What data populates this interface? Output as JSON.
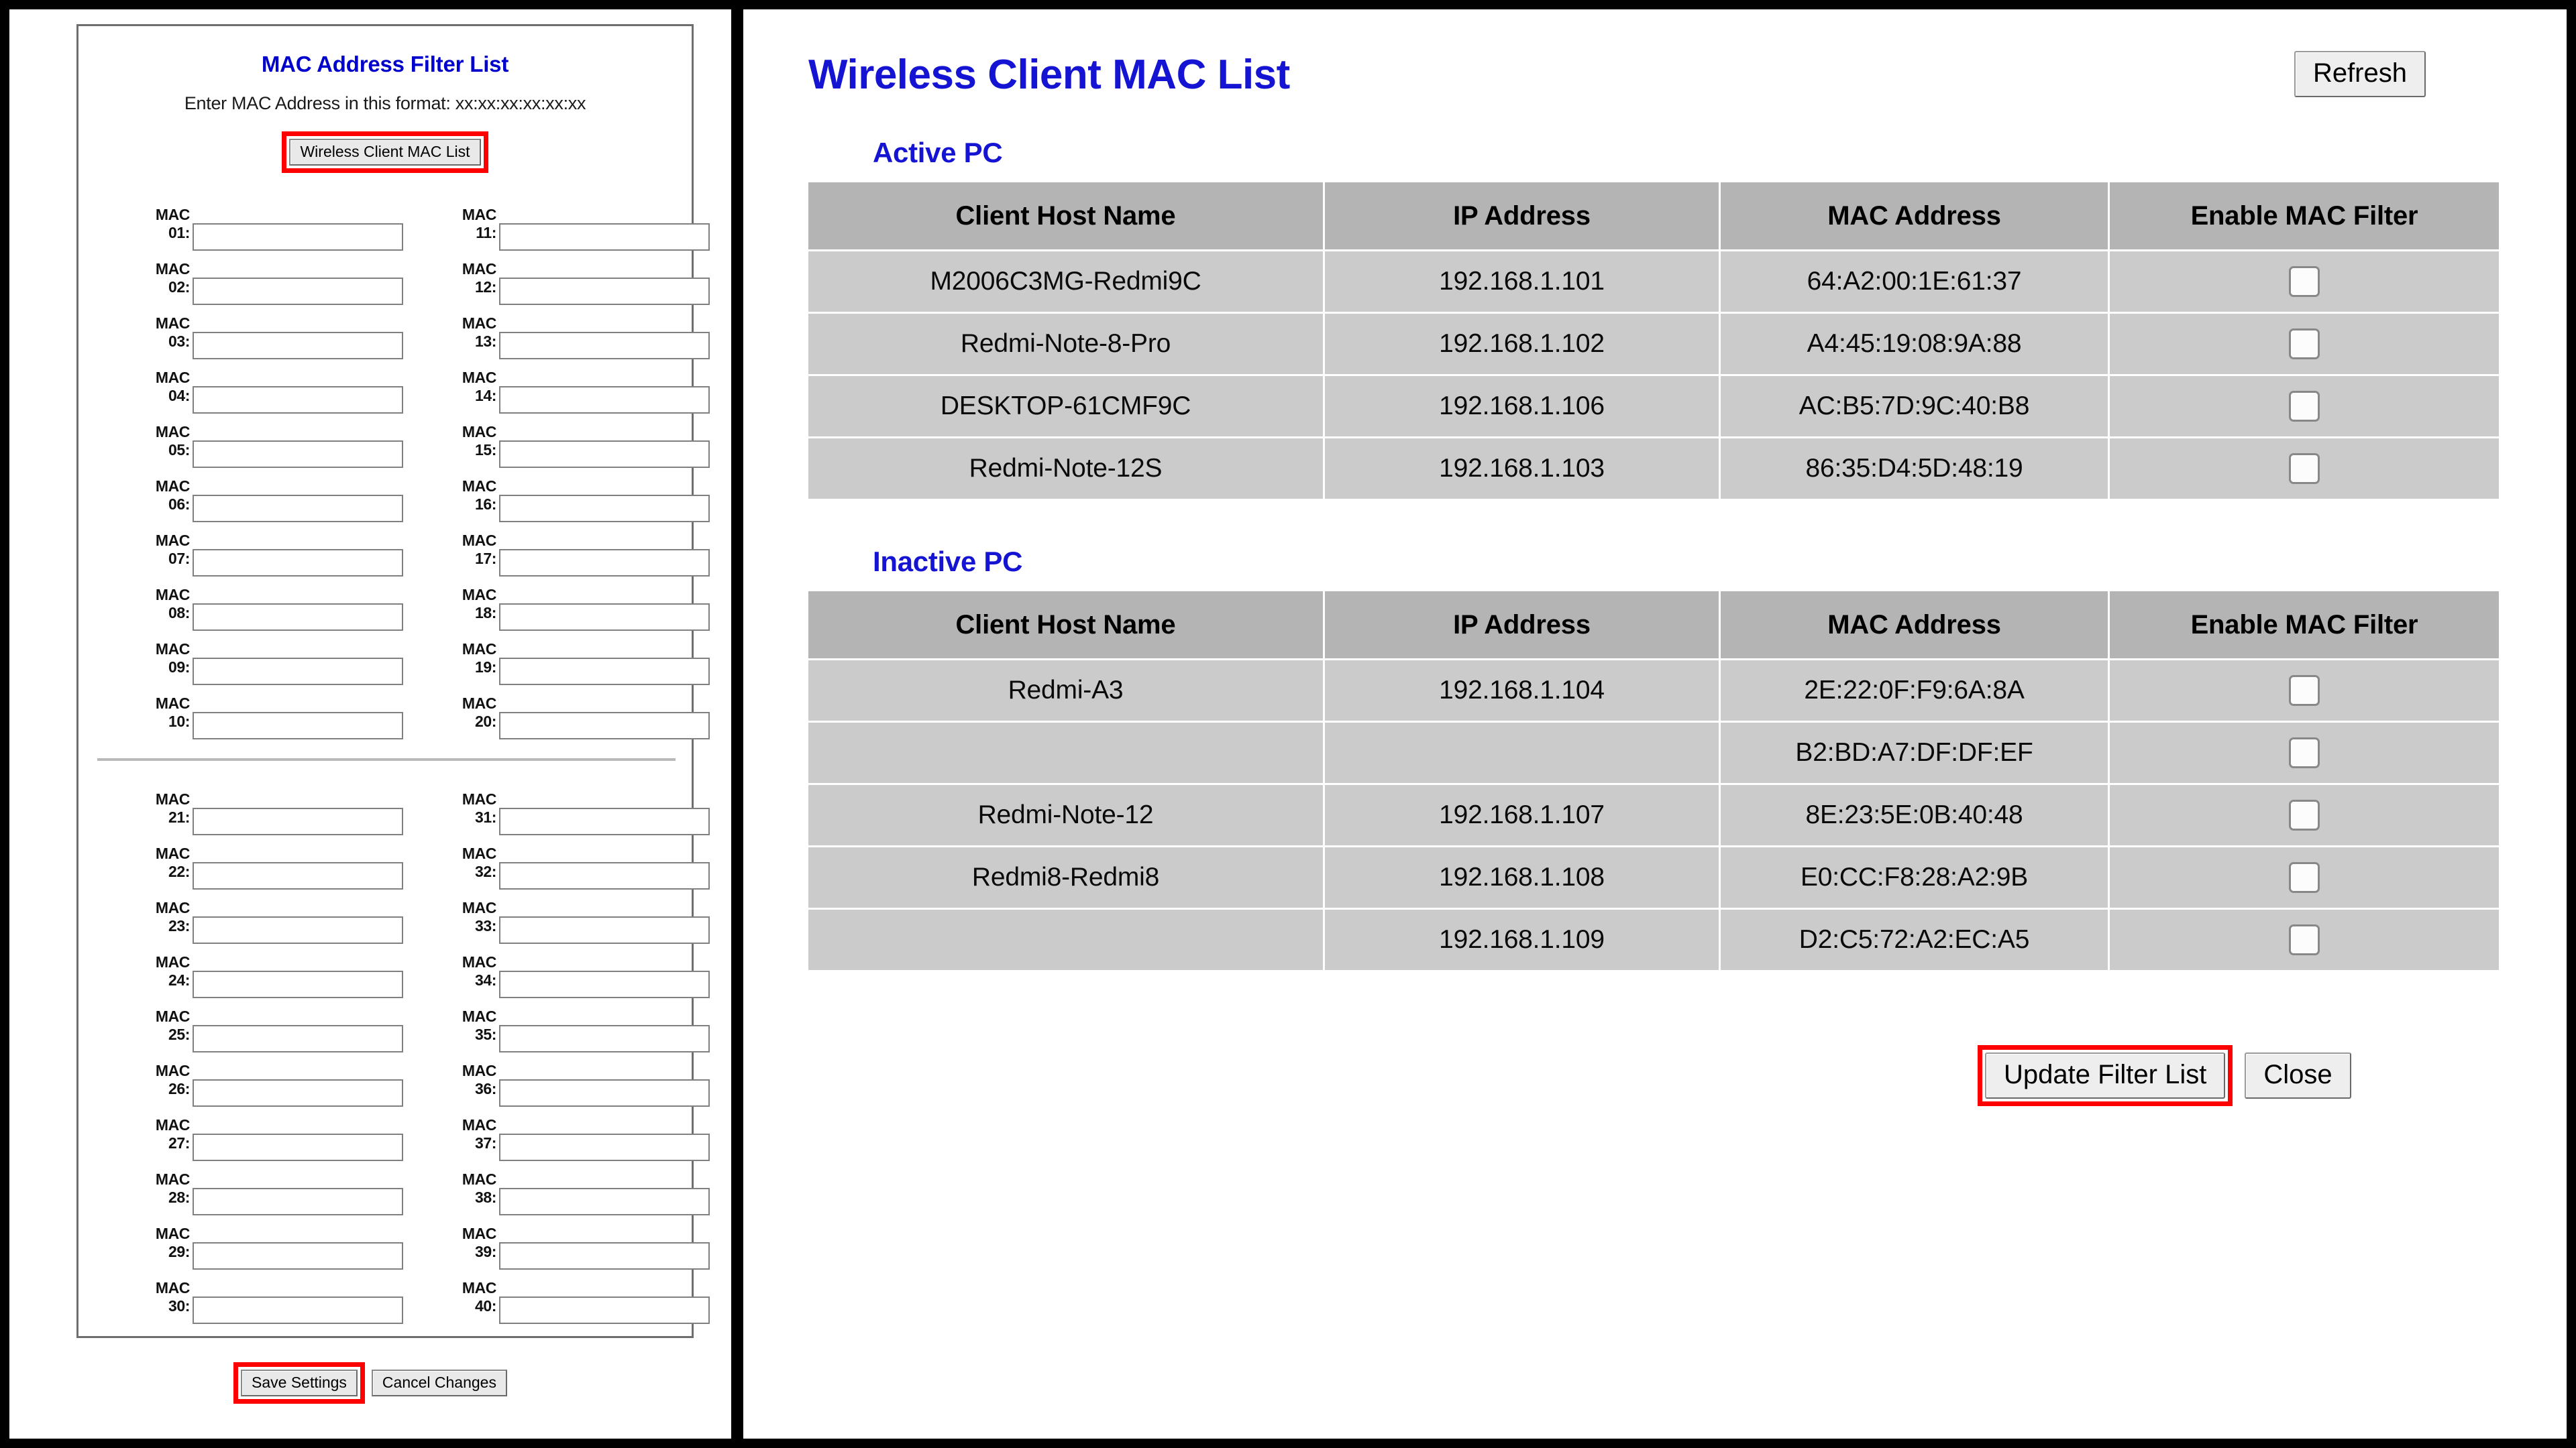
{
  "left_panel": {
    "title": "MAC Address Filter List",
    "subtitle": "Enter MAC Address in this format: xx:xx:xx:xx:xx:xx",
    "wireless_client_button": "Wireless Client MAC List",
    "mac_label_prefix": "MAC",
    "mac_fields_top": [
      {
        "num": "01:",
        "value": ""
      },
      {
        "num": "11:",
        "value": ""
      },
      {
        "num": "02:",
        "value": ""
      },
      {
        "num": "12:",
        "value": ""
      },
      {
        "num": "03:",
        "value": ""
      },
      {
        "num": "13:",
        "value": ""
      },
      {
        "num": "04:",
        "value": ""
      },
      {
        "num": "14:",
        "value": ""
      },
      {
        "num": "05:",
        "value": ""
      },
      {
        "num": "15:",
        "value": ""
      },
      {
        "num": "06:",
        "value": ""
      },
      {
        "num": "16:",
        "value": ""
      },
      {
        "num": "07:",
        "value": ""
      },
      {
        "num": "17:",
        "value": ""
      },
      {
        "num": "08:",
        "value": ""
      },
      {
        "num": "18:",
        "value": ""
      },
      {
        "num": "09:",
        "value": ""
      },
      {
        "num": "19:",
        "value": ""
      },
      {
        "num": "10:",
        "value": ""
      },
      {
        "num": "20:",
        "value": ""
      }
    ],
    "mac_fields_bottom": [
      {
        "num": "21:",
        "value": ""
      },
      {
        "num": "31:",
        "value": ""
      },
      {
        "num": "22:",
        "value": ""
      },
      {
        "num": "32:",
        "value": ""
      },
      {
        "num": "23:",
        "value": ""
      },
      {
        "num": "33:",
        "value": ""
      },
      {
        "num": "24:",
        "value": ""
      },
      {
        "num": "34:",
        "value": ""
      },
      {
        "num": "25:",
        "value": ""
      },
      {
        "num": "35:",
        "value": ""
      },
      {
        "num": "26:",
        "value": ""
      },
      {
        "num": "36:",
        "value": ""
      },
      {
        "num": "27:",
        "value": ""
      },
      {
        "num": "37:",
        "value": ""
      },
      {
        "num": "28:",
        "value": ""
      },
      {
        "num": "38:",
        "value": ""
      },
      {
        "num": "29:",
        "value": ""
      },
      {
        "num": "39:",
        "value": ""
      },
      {
        "num": "30:",
        "value": ""
      },
      {
        "num": "40:",
        "value": ""
      }
    ],
    "save_button": "Save Settings",
    "cancel_button": "Cancel Changes"
  },
  "right_panel": {
    "title": "Wireless Client MAC List",
    "refresh_button": "Refresh",
    "active_section_label": "Active PC",
    "inactive_section_label": "Inactive PC",
    "columns": [
      "Client Host Name",
      "IP Address",
      "MAC Address",
      "Enable MAC Filter"
    ],
    "active_rows": [
      {
        "host": "M2006C3MG-Redmi9C",
        "ip": "192.168.1.101",
        "mac": "64:A2:00:1E:61:37",
        "enabled": false
      },
      {
        "host": "Redmi-Note-8-Pro",
        "ip": "192.168.1.102",
        "mac": "A4:45:19:08:9A:88",
        "enabled": false
      },
      {
        "host": "DESKTOP-61CMF9C",
        "ip": "192.168.1.106",
        "mac": "AC:B5:7D:9C:40:B8",
        "enabled": false
      },
      {
        "host": "Redmi-Note-12S",
        "ip": "192.168.1.103",
        "mac": "86:35:D4:5D:48:19",
        "enabled": false
      }
    ],
    "inactive_rows": [
      {
        "host": "Redmi-A3",
        "ip": "192.168.1.104",
        "mac": "2E:22:0F:F9:6A:8A",
        "enabled": false
      },
      {
        "host": "",
        "ip": "",
        "mac": "B2:BD:A7:DF:DF:EF",
        "enabled": false
      },
      {
        "host": "Redmi-Note-12",
        "ip": "192.168.1.107",
        "mac": "8E:23:5E:0B:40:48",
        "enabled": false
      },
      {
        "host": "Redmi8-Redmi8",
        "ip": "192.168.1.108",
        "mac": "E0:CC:F8:28:A2:9B",
        "enabled": false
      },
      {
        "host": "",
        "ip": "192.168.1.109",
        "mac": "D2:C5:72:A2:EC:A5",
        "enabled": false
      }
    ],
    "update_button": "Update Filter List",
    "close_button": "Close"
  },
  "colors": {
    "annotation_red": "#ee1111",
    "heading_blue": "#1414d2",
    "table_header_gray": "#b4b4b4",
    "table_row_gray": "#cbcbcb",
    "page_border_black": "#000000"
  }
}
